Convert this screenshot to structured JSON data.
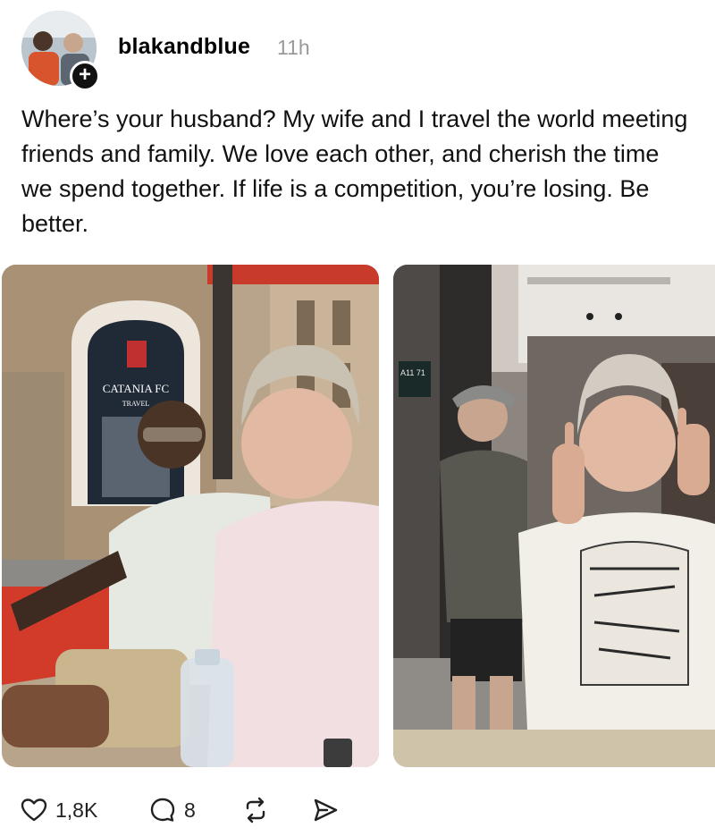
{
  "post": {
    "username": "blakandblue",
    "timestamp": "11h",
    "text": "Where’s your husband? My wife and I travel the world meeting friends and family. We love each other, and cherish the time we spend together. If life is a competition, you’re losing. Be better.",
    "follow_symbol": "+"
  },
  "media": {
    "left_sign": "CATANIA FC",
    "left_sign_sub": "TRAVEL",
    "right_sign": "A11 71"
  },
  "actions": {
    "likes": "1,8K",
    "replies": "8",
    "icons": [
      "heart-icon",
      "comment-icon",
      "repost-icon",
      "share-icon"
    ]
  }
}
